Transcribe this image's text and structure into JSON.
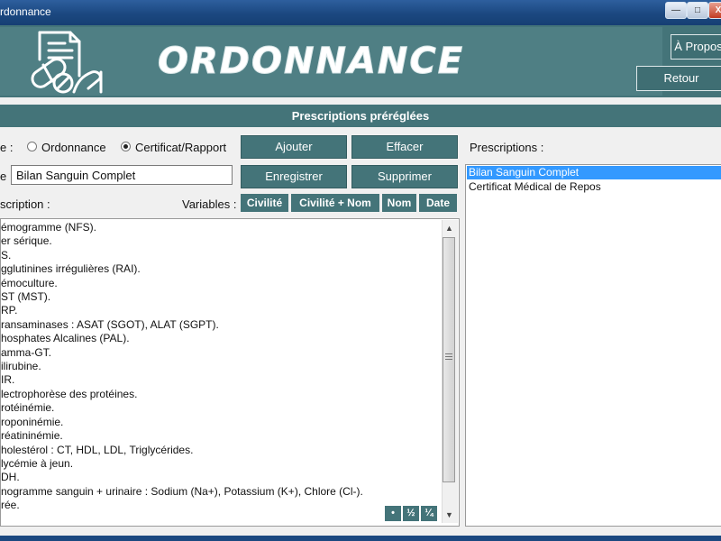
{
  "window": {
    "title": "rdonnance",
    "minimize_label": "—",
    "maximize_label": "□",
    "close_label": "X"
  },
  "banner": {
    "logo_text": "ORDONNANCE",
    "about_label": "À Propos",
    "back_label": "Retour"
  },
  "section_title": "Prescriptions préréglées",
  "type": {
    "label": "e :",
    "options": [
      "Ordonnance",
      "Certificat/Rapport"
    ],
    "selected": "Certificat/Rapport"
  },
  "buttons": {
    "add": "Ajouter",
    "clear": "Effacer",
    "save": "Enregistrer",
    "delete": "Supprimer"
  },
  "title_field": {
    "label": "e :",
    "value": "Bilan Sanguin Complet"
  },
  "description": {
    "label": "scription :",
    "lines": [
      "émogramme (NFS).",
      "er sérique.",
      "S.",
      "gglutinines irrégulières (RAI).",
      "émoculture.",
      "ST (MST).",
      "RP.",
      "ransaminases : ASAT (SGOT), ALAT (SGPT).",
      "hosphates Alcalines (PAL).",
      "amma-GT.",
      "ilirubine.",
      "IR.",
      "lectrophorèse des protéines.",
      "rotéinémie.",
      "roponinémie.",
      "réatininémie.",
      "holestérol : CT, HDL, LDL, Triglycérides.",
      "lycémie à jeun.",
      "DH.",
      "nogramme sanguin + urinaire : Sodium (Na+), Potassium (K+), Chlore (Cl-).",
      "rée."
    ]
  },
  "variables": {
    "label": "Variables :",
    "buttons": [
      "Civilité",
      "Civilité + Nom",
      "Nom",
      "Date"
    ]
  },
  "format_buttons": [
    "•",
    "½",
    "¼"
  ],
  "prescriptions": {
    "label": "Prescriptions :",
    "items": [
      "Bilan Sanguin Complet",
      "Certificat Médical de Repos"
    ],
    "selected_index": 0
  },
  "colors": {
    "accent": "#447479",
    "selection": "#3399ff"
  }
}
